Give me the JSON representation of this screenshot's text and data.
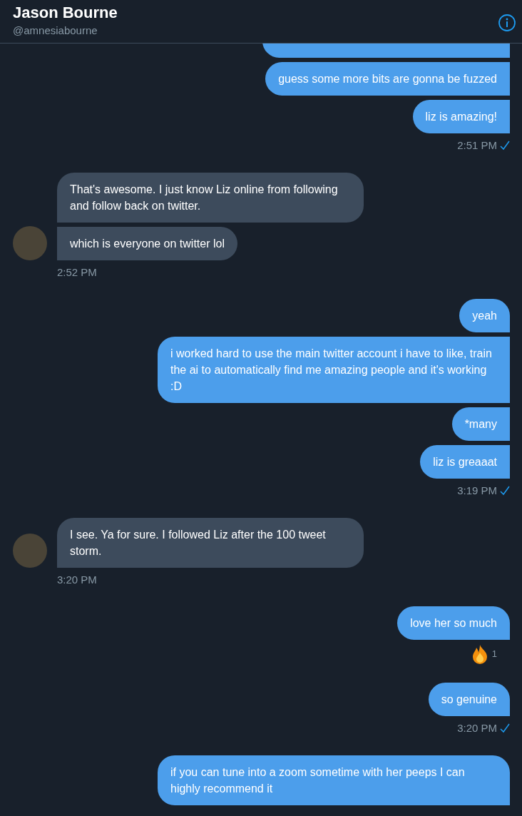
{
  "header": {
    "name": "Jason Bourne",
    "handle": "@amnesiabourne"
  },
  "groups": [
    {
      "kind": "sent",
      "bubbles": [
        {
          "kind": "obscured"
        },
        {
          "kind": "text",
          "text": "guess some more bits are gonna be fuzzed"
        },
        {
          "kind": "text",
          "text": "liz is amazing!"
        }
      ],
      "time": "2:51 PM",
      "read": true
    },
    {
      "kind": "received",
      "bubbles": [
        {
          "kind": "text",
          "text": "That's awesome. I just know Liz online from following and follow back on twitter."
        },
        {
          "kind": "text",
          "text": "which is everyone on twitter lol"
        }
      ],
      "time": "2:52 PM"
    },
    {
      "kind": "sent",
      "bubbles": [
        {
          "kind": "text",
          "text": "yeah"
        },
        {
          "kind": "text",
          "text": "i worked hard to use the main twitter account i have to like, train the ai to automatically find me amazing people and it's working :D"
        },
        {
          "kind": "text",
          "text": "*many"
        },
        {
          "kind": "text",
          "text": "liz is greaaat"
        }
      ],
      "time": "3:19 PM",
      "read": true
    },
    {
      "kind": "received",
      "bubbles": [
        {
          "kind": "text",
          "text": "I see. Ya for sure. I followed Liz after the 100 tweet storm."
        }
      ],
      "time": "3:20 PM"
    },
    {
      "kind": "sent",
      "bubbles": [
        {
          "kind": "text",
          "text": "love her so much",
          "reaction": {
            "count": "1"
          }
        }
      ]
    },
    {
      "kind": "sent",
      "bubbles": [
        {
          "kind": "text",
          "text": "so genuine"
        }
      ],
      "time": "3:20 PM",
      "read": true
    },
    {
      "kind": "sent",
      "bubbles": [
        {
          "kind": "text",
          "text": "if you can tune into a zoom sometime with her peeps I can highly recommend it"
        }
      ]
    }
  ]
}
